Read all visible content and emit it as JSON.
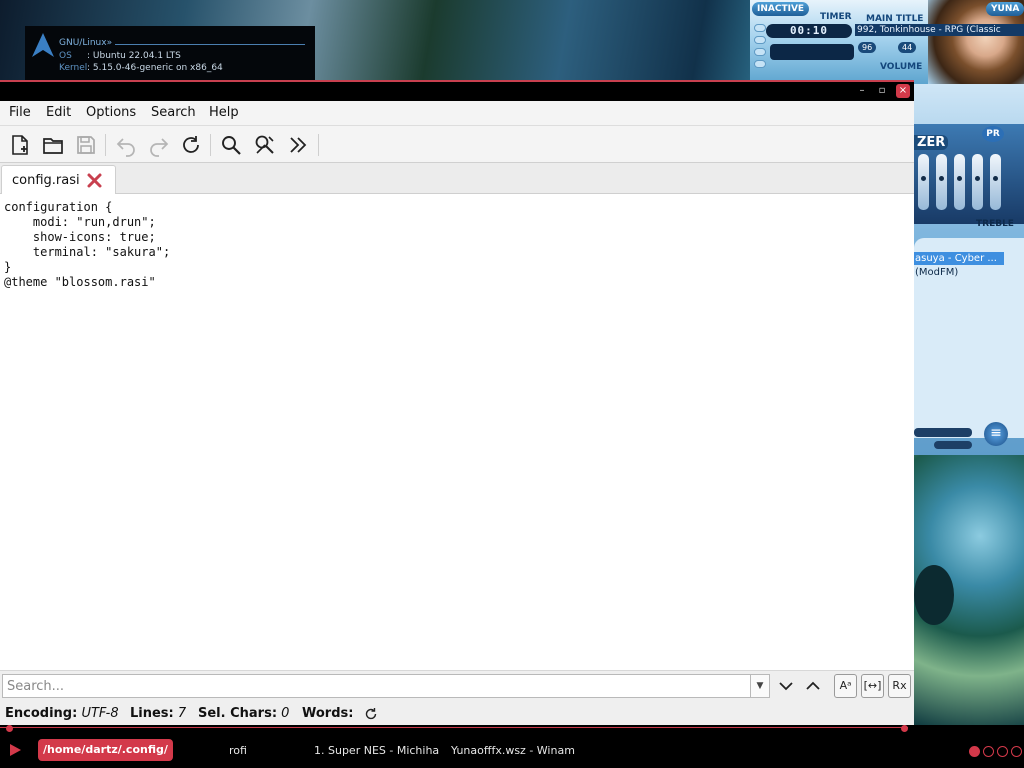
{
  "desktop": {
    "sysinfo": {
      "title": "GNU/Linux»",
      "os_label": "OS",
      "os_value": ": Ubuntu 22.04.1 LTS",
      "kernel_label": "Kernel",
      "kernel_value": ": 5.15.0-46-generic on x86_64"
    },
    "winamp": {
      "inactive_label": "INACTIVE",
      "yuna_label": "YUNA",
      "timer_label": "TIMER",
      "main_title_label": "MAIN TITLE",
      "track_title": "992, Tonkinhouse - RPG (Classic",
      "time": "00:10",
      "kbps": "96",
      "khz": "44",
      "volume_label": "VOLUME",
      "eq_label": "ZER",
      "pr_label": "PR",
      "treble_label": "TREBLE",
      "playlist": [
        "asuya - Cyber ...",
        "(ModFM)"
      ],
      "menu_glyph": "≡"
    }
  },
  "window": {
    "controls": {
      "minimize": "–",
      "maximize": "▫",
      "close": "×"
    },
    "menu": {
      "file": "File",
      "edit": "Edit",
      "options": "Options",
      "search": "Search",
      "help": "Help"
    },
    "toolbar_icons": [
      "new-file-icon",
      "open-file-icon",
      "save-icon",
      "undo-icon",
      "redo-icon",
      "reload-icon",
      "find-icon",
      "find-replace-icon",
      "more-icon"
    ],
    "tab": {
      "label": "config.rasi"
    },
    "document": {
      "lines": [
        "configuration {",
        "    modi: \"run,drun\";",
        "    show-icons: true;",
        "    terminal: \"sakura\";",
        "}",
        "@theme \"blossom.rasi\""
      ]
    },
    "search": {
      "placeholder": "Search...",
      "value": "",
      "match_case": "Aᵃ",
      "whole_word": "[↔]",
      "regex": "Rx"
    },
    "status": {
      "encoding_label": "Encoding:",
      "encoding_value": "UTF-8",
      "lines_label": "Lines:",
      "lines_value": "7",
      "sel_chars_label": "Sel. Chars:",
      "sel_chars_value": "0",
      "words_label": "Words:"
    }
  },
  "taskbar": {
    "active_task": "/home/dartz/.config/",
    "tasks": [
      "rofi",
      "1. Super NES - Michiha",
      "Yunaofffx.wsz - Winam"
    ],
    "workspaces": 4,
    "active_workspace": 1
  },
  "colors": {
    "accent": "#d3394a",
    "text": "#111111",
    "toolbar_bg": "#f4f4f4"
  }
}
